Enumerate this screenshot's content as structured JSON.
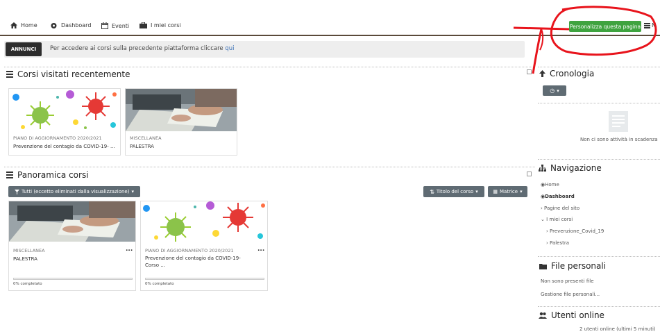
{
  "topnav": {
    "home": "Home",
    "dashboard": "Dashboard",
    "events": "Eventi",
    "my_courses": "I miei corsi",
    "customize": "Personalizza questa pagina",
    "right_partial": "N"
  },
  "announcement": {
    "badge": "ANNUNCI",
    "text": "Per accedere ai corsi sulla precedente piattaforma cliccare ",
    "link": "qui"
  },
  "recent": {
    "title": "Corsi visitati recentemente",
    "cards": [
      {
        "category": "PIANO DI AGGIORNAMENTO 2020/2021",
        "name": "Prevenzione del contagio da COVID-19- ...",
        "image": "virus"
      },
      {
        "category": "MISCELLANEA",
        "name": "PALESTRA",
        "image": "desk"
      }
    ]
  },
  "overview": {
    "title": "Panoramica corsi",
    "filter": "Tutti (eccetto eliminati dalla visualizzazione)",
    "sort": "Titolo del corso",
    "view": "Matrice",
    "cards": [
      {
        "category": "MISCELLANEA",
        "name": "PALESTRA",
        "progress": "0% completato",
        "progress_value": 0,
        "image": "desk"
      },
      {
        "category": "PIANO DI AGGIORNAMENTO 2020/2021",
        "name_line1": "Prevenzione del contagio da COVID-19-",
        "name_line2": "Corso ...",
        "progress": "0% completato",
        "progress_value": 0,
        "image": "virus"
      }
    ],
    "more": "..."
  },
  "timeline": {
    "title": "Cronologia",
    "empty": "Non ci sono attività in scadenza"
  },
  "navigation": {
    "title": "Navigazione",
    "home": "Home",
    "dashboard": "Dashboard",
    "site_pages": "Pagine del sito",
    "my_courses": "I miei corsi",
    "course1": "Prevenzione_Covid_19",
    "course2": "Palestra"
  },
  "files": {
    "title": "File personali",
    "empty": "Non sono presenti file",
    "manage": "Gestione file personali..."
  },
  "online": {
    "title": "Utenti online",
    "text": "2 utenti online (ultimi 5 minuti)"
  },
  "colors": {
    "accent_green": "#3fa33f",
    "annotation_red": "#e8141c",
    "dark_button": "#5f6b73",
    "link": "#3a6fb4"
  }
}
